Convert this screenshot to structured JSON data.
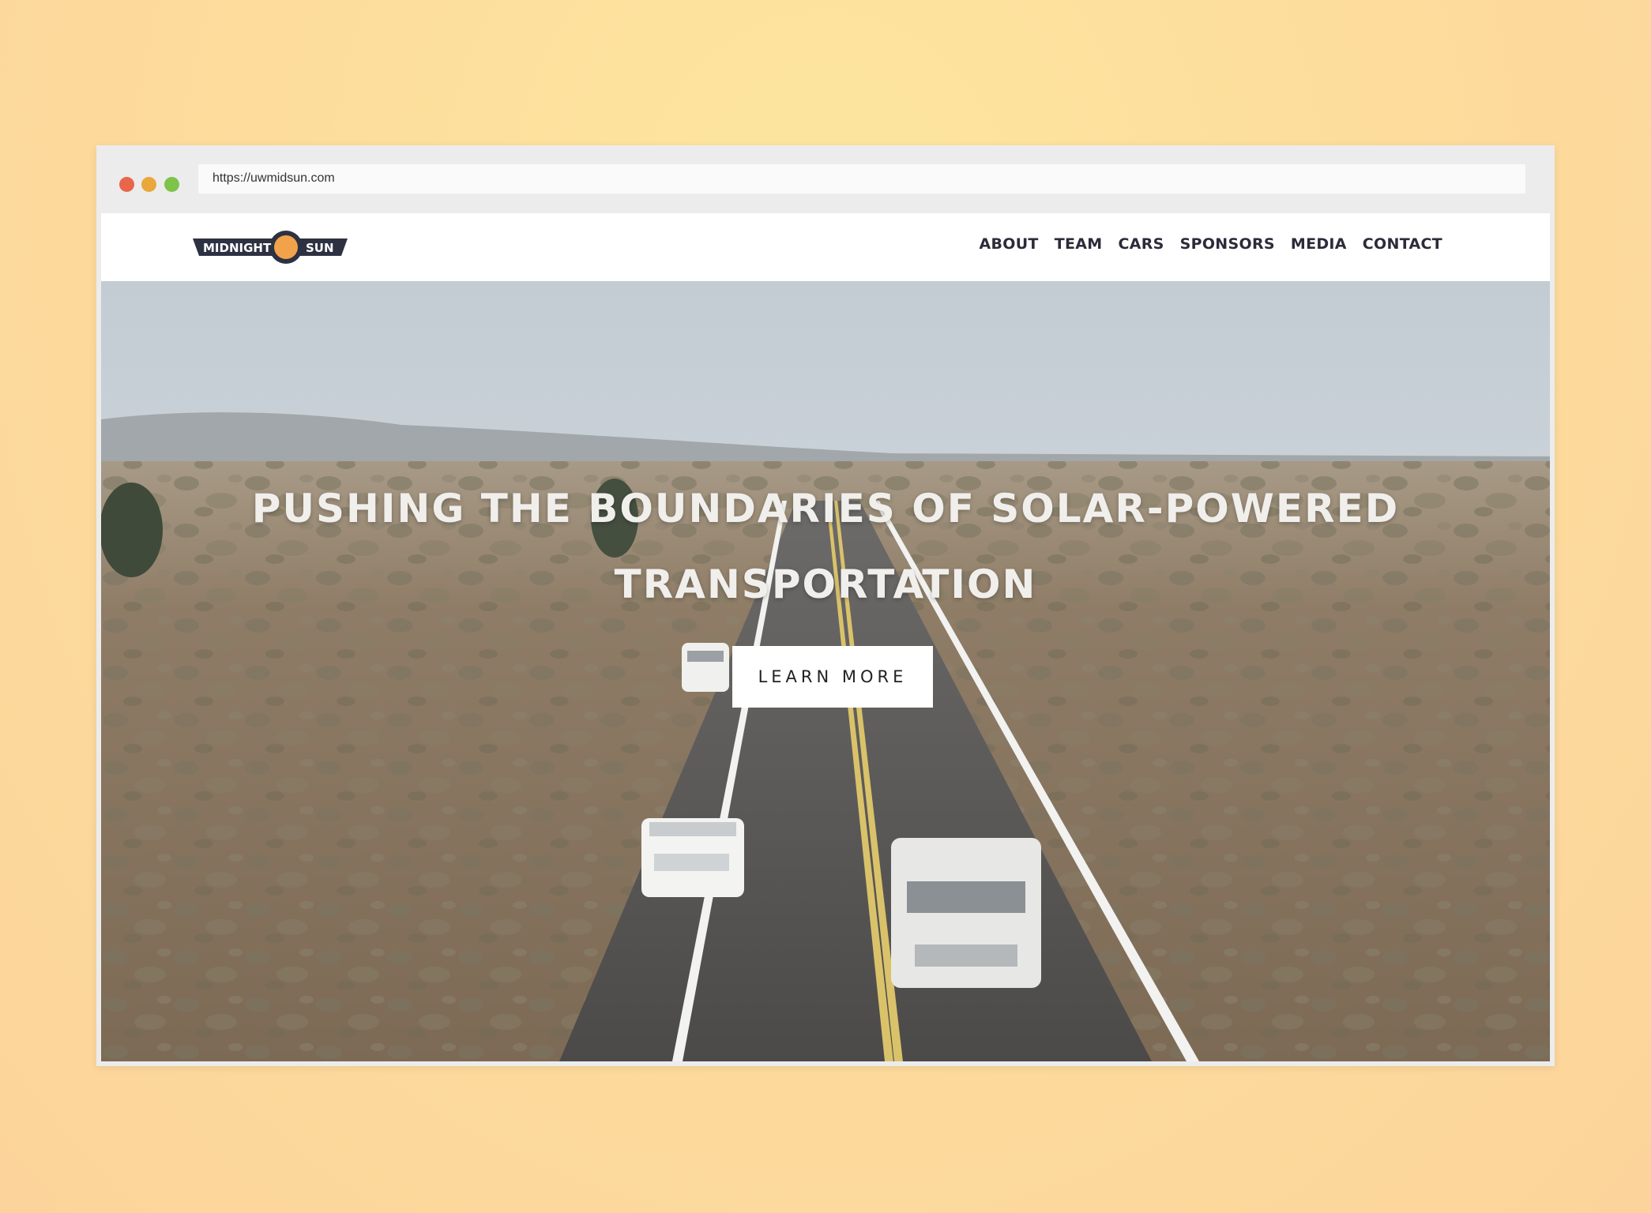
{
  "browser": {
    "url": "https://uwmidsun.com",
    "dots": [
      {
        "name": "close",
        "color": "#e9654b"
      },
      {
        "name": "minimize",
        "color": "#eaa73b"
      },
      {
        "name": "maximize",
        "color": "#7ec34a"
      }
    ]
  },
  "site": {
    "logo": {
      "left_text": "MIDNIGHT",
      "right_text": "SUN",
      "sun_color": "#f2a24a",
      "banner_color": "#2d3142"
    },
    "nav": [
      "ABOUT",
      "TEAM",
      "CARS",
      "SPONSORS",
      "MEDIA",
      "CONTACT"
    ]
  },
  "hero": {
    "headline_line1": "PUSHING THE BOUNDARIES OF SOLAR-POWERED",
    "headline_line2": "TRANSPORTATION",
    "cta_label": "LEARN MORE"
  }
}
